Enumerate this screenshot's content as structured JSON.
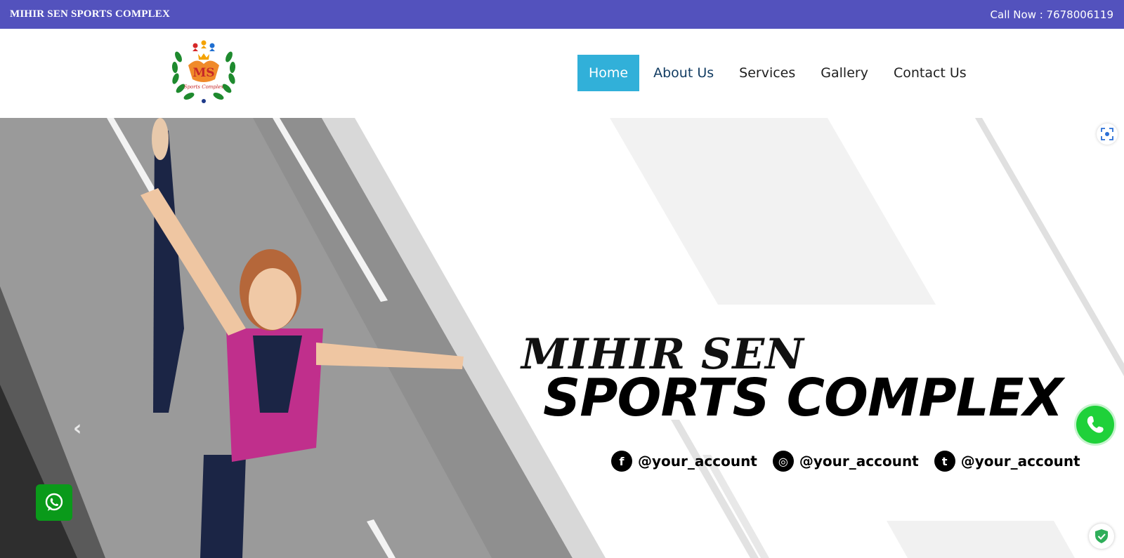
{
  "topbar": {
    "brand": "MIHIR SEN SPORTS COMPLEX",
    "call": "Call Now : 7678006119"
  },
  "logo": {
    "alt": "MS Sports Complex logo",
    "initials": "MS",
    "caption": "Sports Complex"
  },
  "nav": {
    "items": [
      {
        "label": "Home",
        "active": true
      },
      {
        "label": "About Us",
        "active": false
      },
      {
        "label": "Services",
        "active": false
      },
      {
        "label": "Gallery",
        "active": false
      },
      {
        "label": "Contact Us",
        "active": false
      }
    ]
  },
  "hero": {
    "title_line1": "MIHIR SEN",
    "title_line2": "SPORTS COMPLEX",
    "socials": [
      {
        "icon": "facebook-icon",
        "glyph": "f",
        "handle": "@your_account"
      },
      {
        "icon": "instagram-icon",
        "glyph": "◎",
        "handle": "@your_account"
      },
      {
        "icon": "tumblr-icon",
        "glyph": "t",
        "handle": "@your_account"
      }
    ],
    "prev_arrow": "‹"
  },
  "colors": {
    "topbar": "#5352bd",
    "nav_active": "#31b0d9",
    "whatsapp": "#0a9a1a",
    "phone": "#1fd13a"
  }
}
